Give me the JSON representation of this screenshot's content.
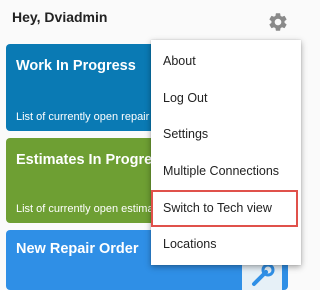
{
  "header": {
    "greeting": "Hey, Dviadmin",
    "settings_icon": "gear-icon"
  },
  "cards": {
    "work_in_progress": {
      "title": "Work In Progress",
      "description": "List of currently open repair",
      "color": "#0a7ab4"
    },
    "estimates": {
      "title": "Estimates In Progress",
      "description": "List of currently open estima",
      "color": "#6e9f33"
    },
    "new_repair_order": {
      "title": "New Repair Order",
      "icon": "wrench-icon",
      "color": "#2f8fe6"
    }
  },
  "menu": {
    "items": [
      {
        "label": "About"
      },
      {
        "label": "Log Out"
      },
      {
        "label": "Settings"
      },
      {
        "label": "Multiple Connections"
      },
      {
        "label": "Switch to Tech view",
        "highlighted": true
      },
      {
        "label": "Locations"
      }
    ],
    "highlight_color": "#e0514b"
  }
}
